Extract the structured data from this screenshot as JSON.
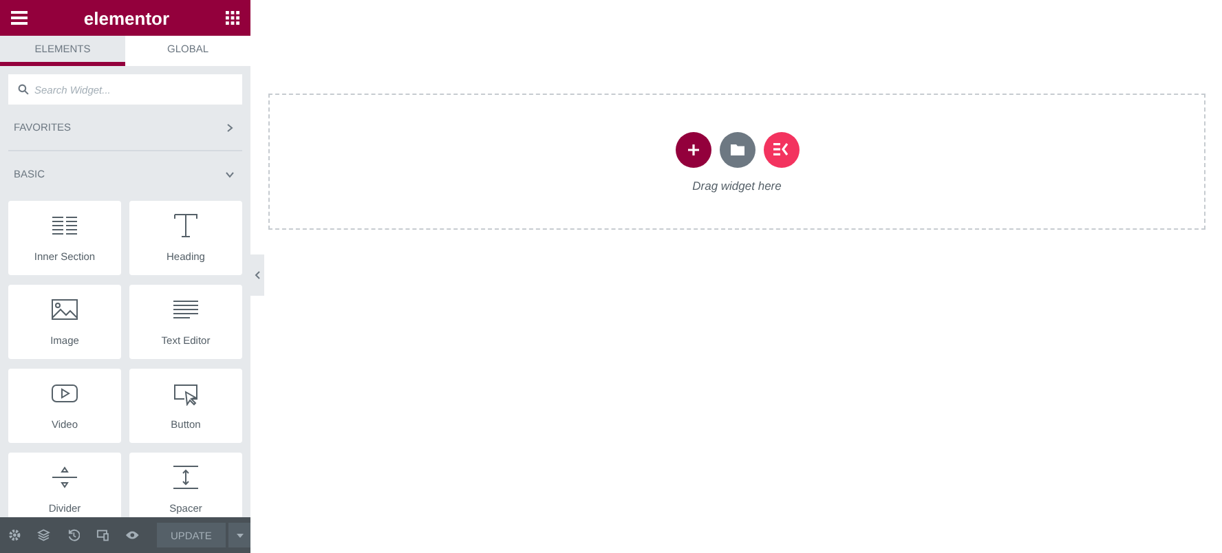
{
  "header": {
    "title": "elementor"
  },
  "tabs": [
    {
      "label": "ELEMENTS",
      "selected": true
    },
    {
      "label": "GLOBAL",
      "selected": false
    }
  ],
  "search": {
    "placeholder": "Search Widget..."
  },
  "categories": [
    {
      "label": "FAVORITES",
      "expanded": false
    },
    {
      "label": "BASIC",
      "expanded": true
    }
  ],
  "widgets": [
    {
      "label": "Inner Section",
      "kind": "inner-section"
    },
    {
      "label": "Heading",
      "kind": "heading"
    },
    {
      "label": "Image",
      "kind": "image"
    },
    {
      "label": "Text Editor",
      "kind": "text-editor"
    },
    {
      "label": "Video",
      "kind": "video"
    },
    {
      "label": "Button",
      "kind": "button"
    },
    {
      "label": "Divider",
      "kind": "divider"
    },
    {
      "label": "Spacer",
      "kind": "spacer"
    }
  ],
  "footer": {
    "update_label": "UPDATE"
  },
  "canvas": {
    "drop_hint": "Drag widget here"
  }
}
